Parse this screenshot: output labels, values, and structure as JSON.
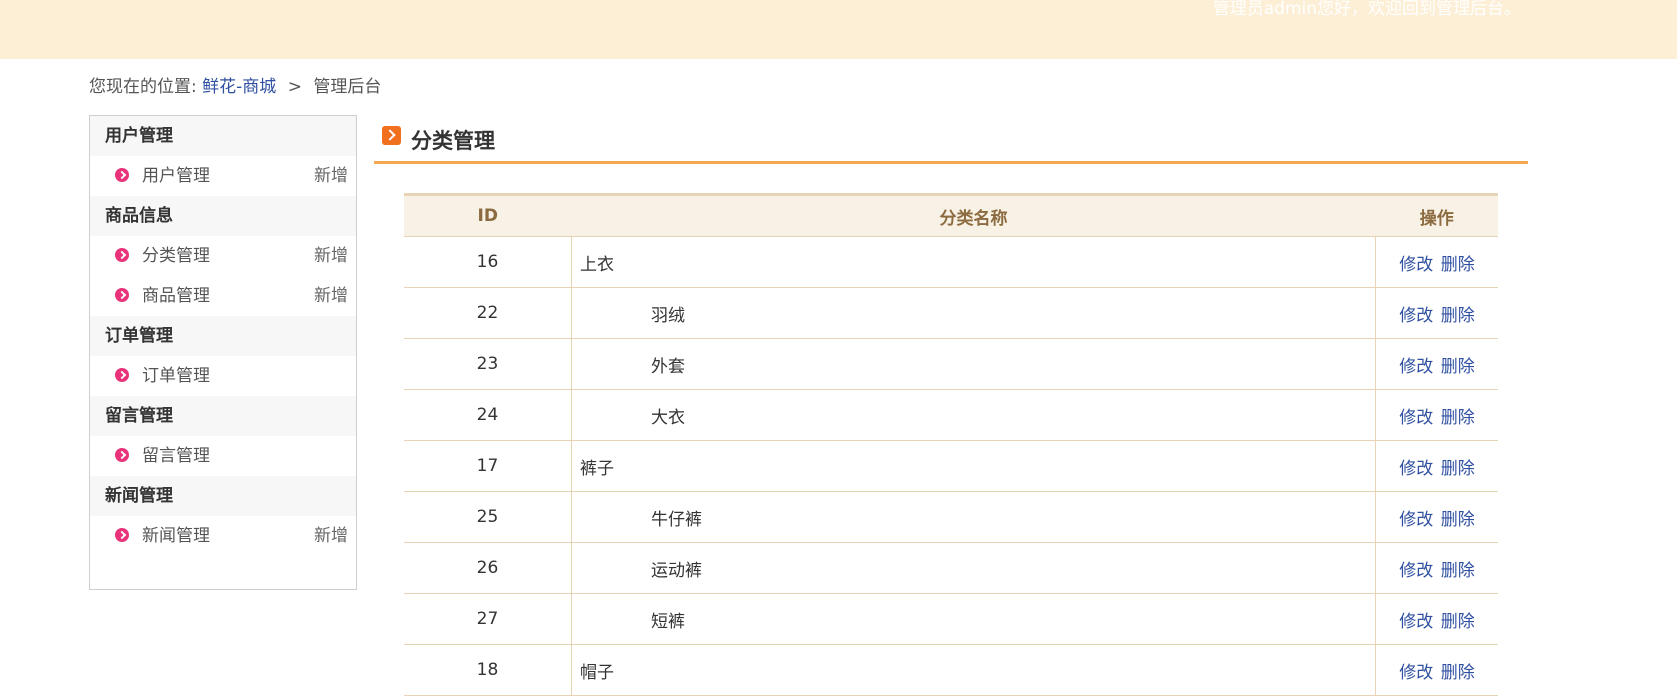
{
  "header": {
    "welcome_text": "管理员admin您好，欢迎回到管理后台。"
  },
  "breadcrumb": {
    "prefix": "您现在的位置:",
    "site_link": "鲜花-商城",
    "separator": ">",
    "current": "管理后台"
  },
  "sidebar": {
    "groups": [
      {
        "title": "用户管理",
        "items": [
          {
            "label": "用户管理",
            "add": "新增"
          }
        ]
      },
      {
        "title": "商品信息",
        "items": [
          {
            "label": "分类管理",
            "add": "新增"
          },
          {
            "label": "商品管理",
            "add": "新增"
          }
        ]
      },
      {
        "title": "订单管理",
        "items": [
          {
            "label": "订单管理",
            "add": ""
          }
        ]
      },
      {
        "title": "留言管理",
        "items": [
          {
            "label": "留言管理",
            "add": ""
          }
        ]
      },
      {
        "title": "新闻管理",
        "items": [
          {
            "label": "新闻管理",
            "add": "新增"
          }
        ]
      }
    ]
  },
  "main": {
    "title": "分类管理",
    "table": {
      "headers": {
        "id": "ID",
        "name": "分类名称",
        "ops": "操作"
      },
      "edit_label": "修改",
      "delete_label": "删除",
      "rows": [
        {
          "id": "16",
          "name": "上衣",
          "child": false
        },
        {
          "id": "22",
          "name": "羽绒",
          "child": true
        },
        {
          "id": "23",
          "name": "外套",
          "child": true
        },
        {
          "id": "24",
          "name": "大衣",
          "child": true
        },
        {
          "id": "17",
          "name": "裤子",
          "child": false
        },
        {
          "id": "25",
          "name": "牛仔裤",
          "child": true
        },
        {
          "id": "26",
          "name": "运动裤",
          "child": true
        },
        {
          "id": "27",
          "name": "短裤",
          "child": true
        },
        {
          "id": "18",
          "name": "帽子",
          "child": false
        }
      ]
    }
  },
  "colors": {
    "topbar_bg": "#fdefd6",
    "accent_orange": "#f4a94f",
    "link_blue": "#2f4fa0",
    "bullet_pink": "#e8337a",
    "table_header_text": "#8b6b3f"
  }
}
